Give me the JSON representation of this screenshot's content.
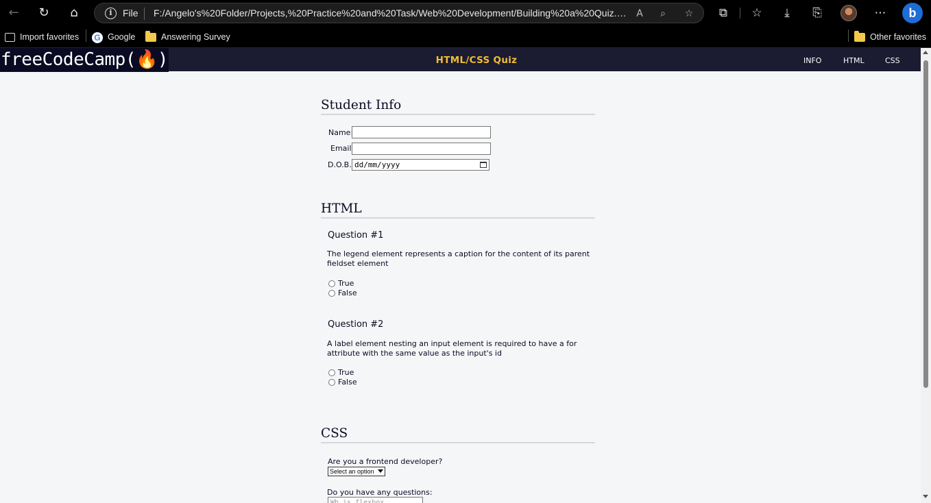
{
  "browser": {
    "address": {
      "scheme": "File",
      "url": "F:/Angelo's%20Folder/Projects,%20Practice%20and%20Task/Web%20Development/Building%20a%20Quiz.Acce..."
    },
    "icons": {
      "back": "back-arrow-icon",
      "refresh": "refresh-icon",
      "home": "home-icon",
      "info": "info-icon",
      "read_aloud": "read-aloud-icon",
      "zoom": "zoom-icon",
      "favorite_add": "add-favorite-icon",
      "extensions": "extensions-icon",
      "favorites": "favorites-icon",
      "downloads": "downloads-icon",
      "collections": "collections-icon",
      "profile": "profile-avatar",
      "more": "more-icon",
      "bing": "bing-icon"
    },
    "info_glyph": "i",
    "bing_glyph": "b",
    "bookmarks": [
      {
        "label": "Import favorites",
        "icon": "import-icon"
      },
      {
        "label": "Google",
        "icon": "google-icon",
        "glyph": "G"
      },
      {
        "label": "Answering Survey",
        "icon": "folder-icon"
      }
    ],
    "other_favorites": "Other favorites"
  },
  "site": {
    "logo": "freeCodeCamp(🔥)",
    "title": "HTML/CSS Quiz",
    "nav": [
      "INFO",
      "HTML",
      "CSS"
    ],
    "colors": {
      "header_bg": "#1b1b32",
      "logo_bg": "#0a0a23",
      "title": "#f1be32"
    }
  },
  "student_info": {
    "heading": "Student Info",
    "name_label": "Name:",
    "email_label": "Email:",
    "dob_label": "D.O.B.",
    "dob_placeholder": "dd/mm/yyyy"
  },
  "html_section": {
    "heading": "HTML",
    "questions": [
      {
        "title": "Question #1",
        "text": "The legend element represents a caption for the content of its parent fieldset element",
        "options": [
          "True",
          "False"
        ]
      },
      {
        "title": "Question #2",
        "text": "A label element nesting an input element is required to have a for attribute with the same value as the input's id",
        "options": [
          "True",
          "False"
        ]
      }
    ]
  },
  "css_section": {
    "heading": "CSS",
    "frontend_label": "Are you a frontend developer?",
    "frontend_select": "Select an option",
    "questions_label": "Do you have any questions:",
    "questions_placeholder": "Wh is flexbox"
  }
}
